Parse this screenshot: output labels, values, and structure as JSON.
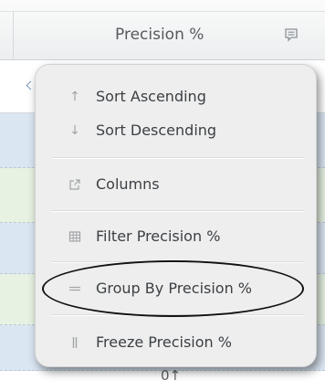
{
  "grid": {
    "column_header": "Precision %",
    "footer_partial": "0↑"
  },
  "menu": {
    "sort_asc": "Sort Ascending",
    "sort_desc": "Sort Descending",
    "columns": "Columns",
    "filter": "Filter Precision %",
    "group_by": "Group By Precision %",
    "freeze": "Freeze Precision %"
  },
  "icons": {
    "sort_asc": "arrow-up",
    "sort_desc": "arrow-down",
    "columns": "external-link",
    "filter": "grid-filter",
    "group_by": "double-dash",
    "freeze": "double-bar",
    "header_menu": "comment-menu"
  },
  "colors": {
    "row_blue": "#dbe6f3",
    "row_green": "#e7f2e3",
    "menu_bg": "#eeeeee",
    "annotation": "#111111"
  }
}
